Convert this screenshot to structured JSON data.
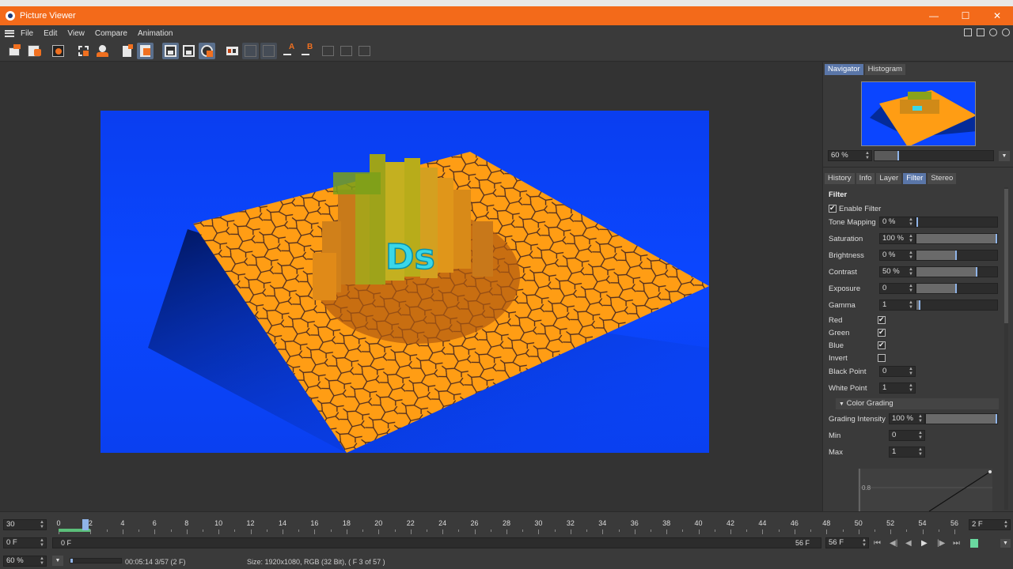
{
  "window": {
    "title": "Picture Viewer",
    "minimize": "—",
    "maximize": "☐",
    "close": "✕"
  },
  "menu": [
    "File",
    "Edit",
    "View",
    "Compare",
    "Animation"
  ],
  "right_panel": {
    "top_tabs": [
      {
        "label": "Navigator",
        "active": true
      },
      {
        "label": "Histogram",
        "active": false
      }
    ],
    "nav_zoom": "60 %",
    "nav_zoom_level": 0.2,
    "lower_tabs": [
      {
        "label": "History",
        "active": false
      },
      {
        "label": "Info",
        "active": false
      },
      {
        "label": "Layer",
        "active": false
      },
      {
        "label": "Filter",
        "active": true
      },
      {
        "label": "Stereo",
        "active": false
      }
    ],
    "filter": {
      "section": "Filter",
      "enable_label": "Enable Filter",
      "enabled": true,
      "params": [
        {
          "label": "Tone Mapping",
          "value": "0 %",
          "level": 0.0
        },
        {
          "label": "Saturation",
          "value": "100 %",
          "level": 1.0
        },
        {
          "label": "Brightness",
          "value": "0 %",
          "level": 0.5
        },
        {
          "label": "Contrast",
          "value": "50 %",
          "level": 0.75
        },
        {
          "label": "Exposure",
          "value": "0",
          "level": 0.5
        },
        {
          "label": "Gamma",
          "value": "1",
          "level": 0.05
        }
      ],
      "channels": [
        {
          "label": "Red",
          "checked": true
        },
        {
          "label": "Green",
          "checked": true
        },
        {
          "label": "Blue",
          "checked": true
        },
        {
          "label": "Invert",
          "checked": false
        }
      ],
      "black_point_label": "Black Point",
      "black_point": "0",
      "white_point_label": "White Point",
      "white_point": "1",
      "color_grading": {
        "header": "Color Grading",
        "intensity_label": "Grading Intensity",
        "intensity": "100 %",
        "min_label": "Min",
        "min": "0",
        "max_label": "Max",
        "max": "1",
        "curve_tick": "0.8"
      }
    }
  },
  "timeline": {
    "fps": "30",
    "start": "0 F",
    "range_start": "0 F",
    "range_end": "56 F",
    "end_field": "56 F",
    "current_frame_field": "2 F",
    "tick_labels": [
      "0",
      "2",
      "4",
      "6",
      "8",
      "10",
      "12",
      "14",
      "16",
      "18",
      "20",
      "22",
      "24",
      "26",
      "28",
      "30",
      "32",
      "34",
      "36",
      "38",
      "40",
      "42",
      "44",
      "46",
      "48",
      "50",
      "52",
      "54",
      "56"
    ],
    "current_frame": 2,
    "total_frames": 56
  },
  "status": {
    "zoom": "60 %",
    "time": "00:05:14 3/57 (2 F)",
    "info": "Size: 1920x1080, RGB (32 Bit),  ( F 3 of 57 )"
  },
  "render_text": "Ds",
  "colors": {
    "titlebar": "#f36a1a",
    "render_bg": "#0b47ff",
    "ground": "#ff9d14",
    "active_tab": "#5a76a8"
  }
}
